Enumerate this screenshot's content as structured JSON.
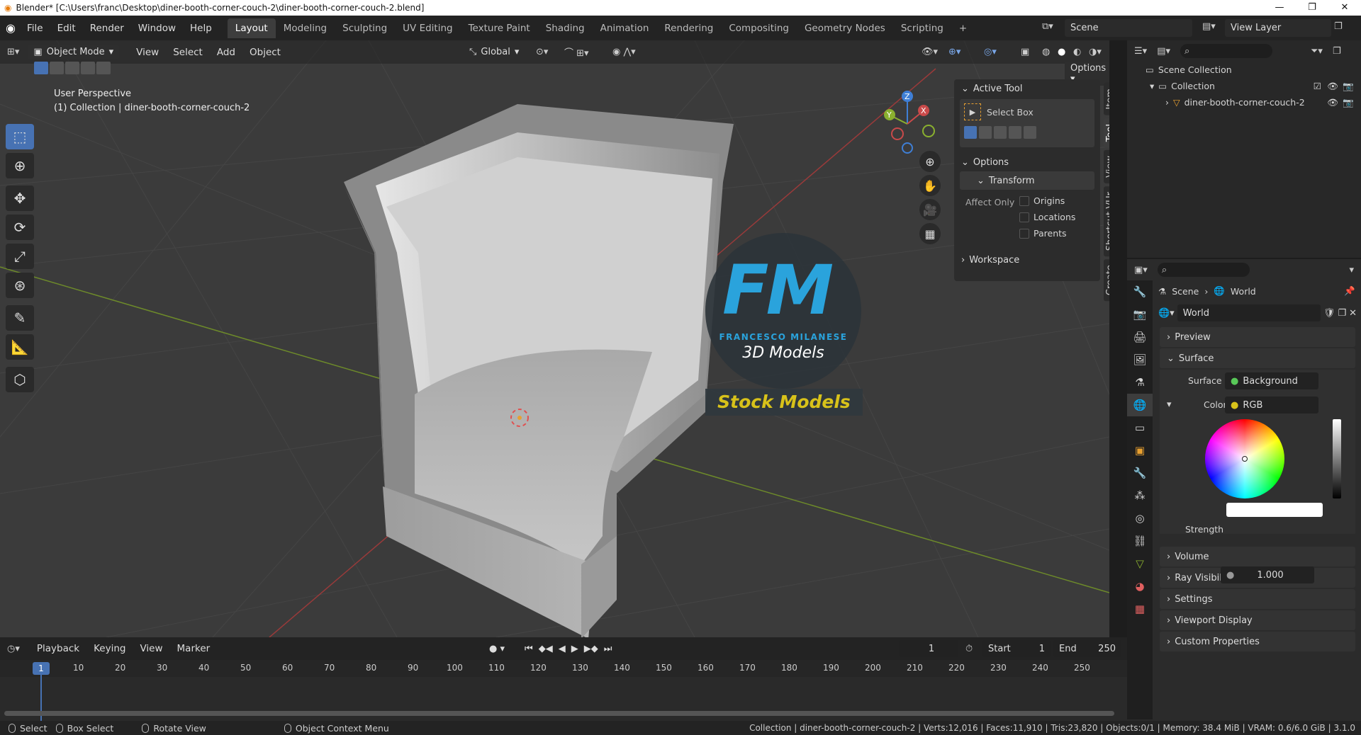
{
  "window": {
    "title": "Blender* [C:\\Users\\franc\\Desktop\\diner-booth-corner-couch-2\\diner-booth-corner-couch-2.blend]",
    "controls": [
      "—",
      "❐",
      "✕"
    ]
  },
  "menu": [
    "File",
    "Edit",
    "Render",
    "Window",
    "Help"
  ],
  "workspaces": [
    "Layout",
    "Modeling",
    "Sculpting",
    "UV Editing",
    "Texture Paint",
    "Shading",
    "Animation",
    "Rendering",
    "Compositing",
    "Geometry Nodes",
    "Scripting"
  ],
  "active_workspace": "Layout",
  "scene": "Scene",
  "view_layer": "View Layer",
  "viewport": {
    "mode": "Object Mode",
    "menu": [
      "View",
      "Select",
      "Add",
      "Object"
    ],
    "transform_orientation": "Global",
    "options_label": "Options",
    "info_line1": "User Perspective",
    "info_line2": "(1) Collection | diner-booth-corner-couch-2"
  },
  "watermark": {
    "logo_fm": "FM",
    "name": "FRANCESCO MILANESE",
    "sub": "3D Models",
    "stock": "Stock Models"
  },
  "npanel": {
    "active_tool_header": "Active Tool",
    "tool_name": "Select Box",
    "options_header": "Options",
    "transform_header": "Transform",
    "affect_only": "Affect Only",
    "checks": [
      "Origins",
      "Locations",
      "Parents"
    ],
    "workspace_header": "Workspace",
    "tabs": [
      "Item",
      "Tool",
      "View",
      "Shortcut VUr",
      "Create"
    ],
    "active_tab": "Tool"
  },
  "outliner": {
    "root": "Scene Collection",
    "collection": "Collection",
    "object": "diner-booth-corner-couch-2"
  },
  "properties": {
    "breadcrumb_scene": "Scene",
    "breadcrumb_world": "World",
    "world_name": "World",
    "sections": {
      "preview": "Preview",
      "surface": "Surface",
      "volume": "Volume",
      "ray_visibility": "Ray Visibility",
      "settings": "Settings",
      "viewport_display": "Viewport Display",
      "custom_properties": "Custom Properties"
    },
    "surface_label": "Surface",
    "surface_value": "Background",
    "color_label": "Color",
    "color_value": "RGB",
    "strength_label": "Strength",
    "strength_value": "1.000"
  },
  "timeline": {
    "menu": [
      "Playback",
      "Keying",
      "View",
      "Marker"
    ],
    "current_frame": "1",
    "start_label": "Start",
    "start": "1",
    "end_label": "End",
    "end": "250",
    "ticks": [
      "1",
      "10",
      "20",
      "30",
      "40",
      "50",
      "60",
      "70",
      "80",
      "90",
      "100",
      "110",
      "120",
      "130",
      "140",
      "150",
      "160",
      "170",
      "180",
      "190",
      "200",
      "210",
      "220",
      "230",
      "240",
      "250"
    ]
  },
  "statusbar": {
    "select": "Select",
    "box_select": "Box Select",
    "rotate_view": "Rotate View",
    "context_menu": "Object Context Menu",
    "stats": "Collection | diner-booth-corner-couch-2 | Verts:12,016 | Faces:11,910 | Tris:23,820 | Objects:0/1 | Memory: 38.4 MiB | VRAM: 0.6/6.0 GiB | 3.1.0"
  },
  "colors": {
    "accent": "#4772b3",
    "fm_blue": "#2aa3dc",
    "stock_yellow": "#d8c21a",
    "x_axis": "#c94a4a",
    "y_axis": "#8ab02f",
    "z_axis": "#3f7fd6"
  }
}
